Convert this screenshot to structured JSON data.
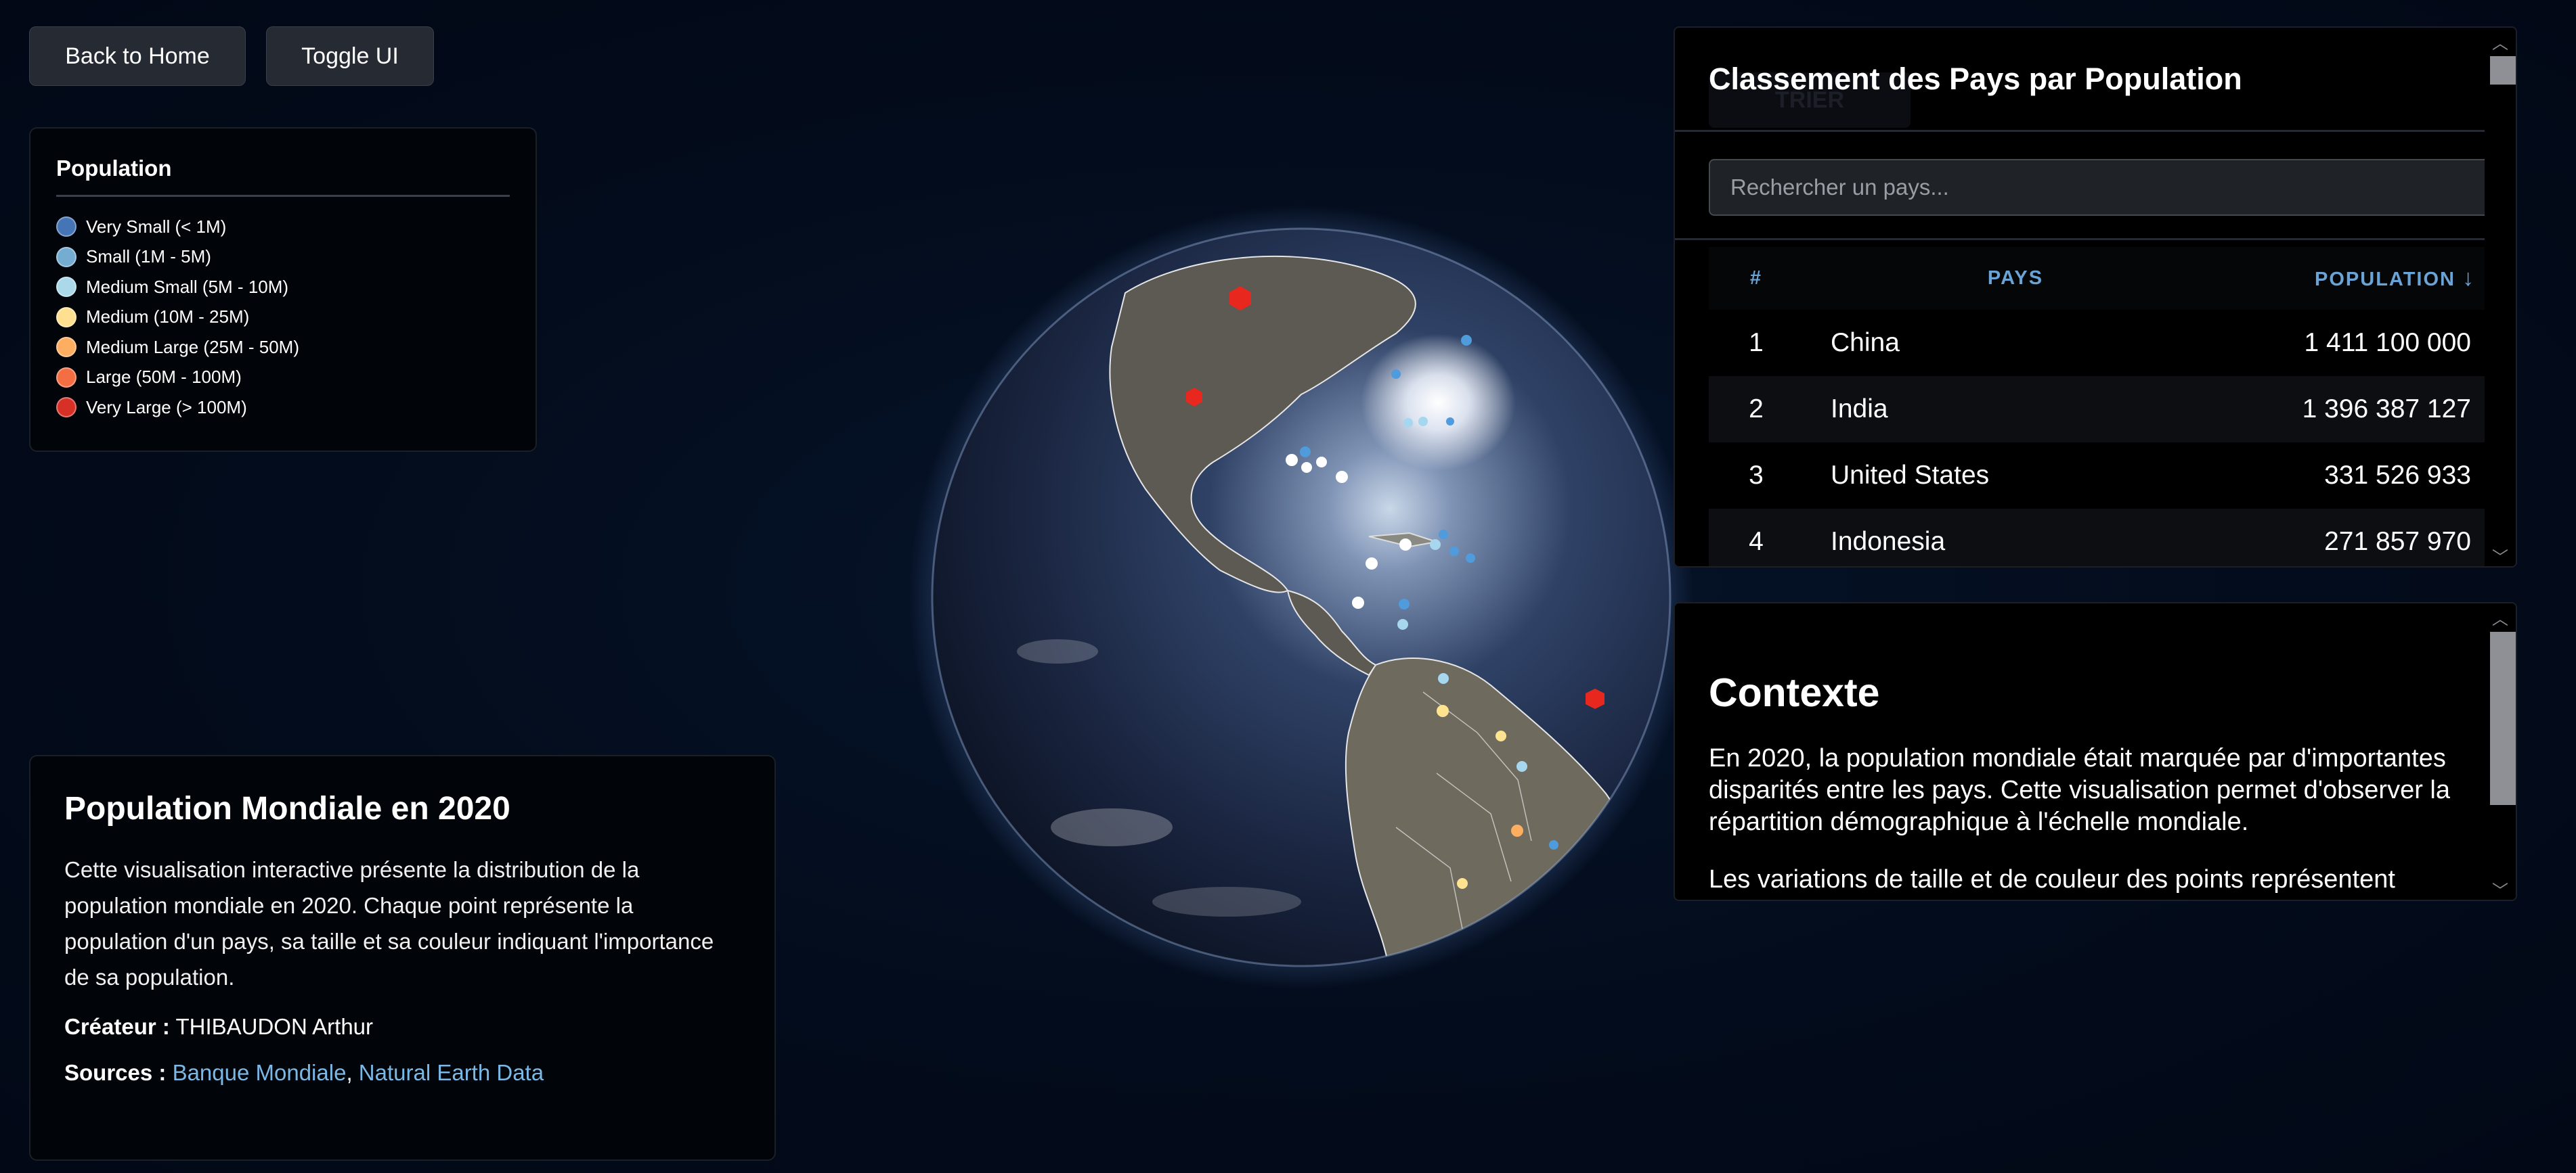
{
  "buttons": {
    "home": "Back to Home",
    "toggle": "Toggle UI"
  },
  "legend": {
    "title": "Population",
    "items": [
      {
        "label": "Very Small (< 1M)",
        "color": "#4575b4"
      },
      {
        "label": "Small (1M - 5M)",
        "color": "#74add1"
      },
      {
        "label": "Medium Small (5M - 10M)",
        "color": "#abd9e9"
      },
      {
        "label": "Medium (10M - 25M)",
        "color": "#fee090"
      },
      {
        "label": "Medium Large (25M - 50M)",
        "color": "#fdae61"
      },
      {
        "label": "Large (50M - 100M)",
        "color": "#f46d43"
      },
      {
        "label": "Very Large (> 100M)",
        "color": "#d73027"
      }
    ]
  },
  "info": {
    "title": "Population Mondiale en 2020",
    "description": "Cette visualisation interactive présente la distribution de la population mondiale en 2020. Chaque point représente la population d'un pays, sa taille et sa couleur indiquant l'importance de sa population.",
    "creator_label": "Créateur :",
    "creator": "THIBAUDON Arthur",
    "sources_label": "Sources :",
    "source_1": "Banque Mondiale",
    "separator": ",",
    "source_2": "Natural Earth Data"
  },
  "ranking": {
    "title": "Classement des Pays par Population",
    "ghost_button": "TRIER",
    "search_placeholder": "Rechercher un pays...",
    "columns": {
      "rank": "#",
      "country": "PAYS",
      "population": "POPULATION",
      "sort_icon": "↓"
    },
    "rows": [
      {
        "rank": "1",
        "country": "China",
        "population": "1 411 100 000"
      },
      {
        "rank": "2",
        "country": "India",
        "population": "1 396 387 127"
      },
      {
        "rank": "3",
        "country": "United States",
        "population": "331 526 933"
      },
      {
        "rank": "4",
        "country": "Indonesia",
        "population": "271 857 970"
      }
    ]
  },
  "context": {
    "title": "Contexte",
    "paragraph_1": "En 2020, la population mondiale était marquée par d'importantes disparités entre les pays. Cette visualisation permet d'observer la répartition démographique à l'échelle mondiale.",
    "paragraph_2": "Les variations de taille et de couleur des points représentent"
  },
  "scroll_icons": {
    "up": "up-arrow-icon",
    "down": "down-arrow-icon"
  }
}
